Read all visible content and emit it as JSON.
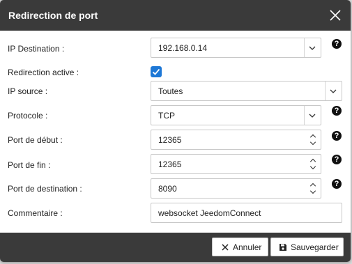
{
  "dialog": {
    "title": "Redirection de port",
    "close_icon": "close-icon"
  },
  "fields": {
    "ip_destination": {
      "label": "IP Destination :",
      "value": "192.168.0.14"
    },
    "redirection_active": {
      "label": "Redirection active :",
      "checked": true
    },
    "ip_source": {
      "label": "IP source :",
      "value": "Toutes"
    },
    "protocole": {
      "label": "Protocole :",
      "value": "TCP"
    },
    "port_debut": {
      "label": "Port de début :",
      "value": "12365"
    },
    "port_fin": {
      "label": "Port de fin :",
      "value": "12365"
    },
    "port_destination": {
      "label": "Port de destination :",
      "value": "8090"
    },
    "commentaire": {
      "label": "Commentaire :",
      "value": "websocket JeedomConnect"
    }
  },
  "help_glyph": "?",
  "footer": {
    "cancel_label": "Annuler",
    "save_label": "Sauvegarder"
  },
  "colors": {
    "titlebar": "#3a3a3a",
    "checkbox": "#1e78d6"
  }
}
